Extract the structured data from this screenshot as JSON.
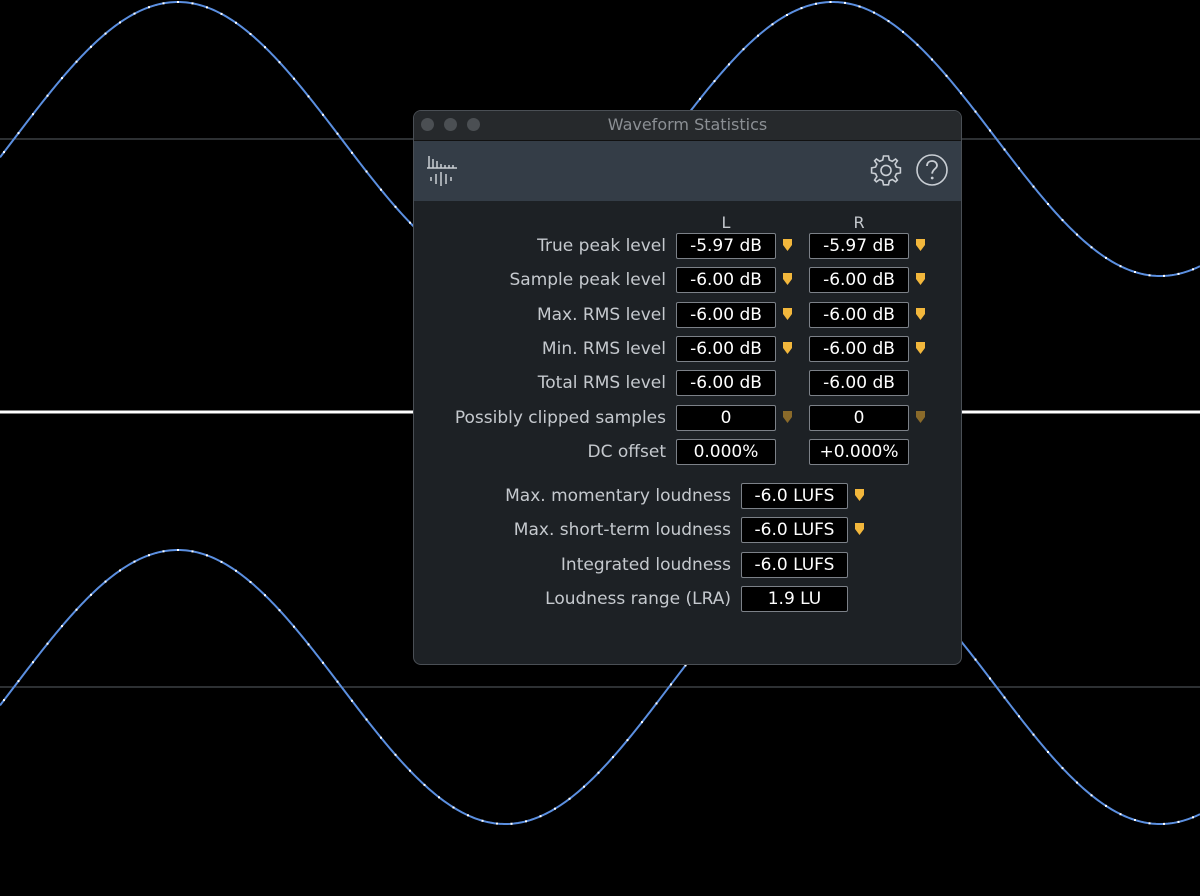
{
  "window": {
    "title": "Waveform Statistics"
  },
  "toolbar": {
    "icons": [
      "waveform-statistics-icon",
      "gear-icon",
      "help-icon"
    ]
  },
  "columns": {
    "left": "L",
    "right": "R"
  },
  "channel_stats": [
    {
      "label": "True peak level",
      "left": "-5.97 dB",
      "right": "-5.97 dB",
      "marker": "active"
    },
    {
      "label": "Sample peak level",
      "left": "-6.00 dB",
      "right": "-6.00 dB",
      "marker": "active"
    },
    {
      "label": "Max. RMS level",
      "left": "-6.00 dB",
      "right": "-6.00 dB",
      "marker": "active"
    },
    {
      "label": "Min. RMS level",
      "left": "-6.00 dB",
      "right": "-6.00 dB",
      "marker": "active"
    },
    {
      "label": "Total RMS level",
      "left": "-6.00 dB",
      "right": "-6.00 dB",
      "marker": "none"
    },
    {
      "label": "Possibly clipped samples",
      "left": "0",
      "right": "0",
      "marker": "dim"
    },
    {
      "label": "DC offset",
      "left": "0.000%",
      "right": "+0.000%",
      "marker": "none"
    }
  ],
  "loudness_stats": [
    {
      "label": "Max. momentary loudness",
      "value": "-6.0 LUFS",
      "marker": "active"
    },
    {
      "label": "Max. short-term loudness",
      "value": "-6.0 LUFS",
      "marker": "active"
    },
    {
      "label": "Integrated loudness",
      "value": "-6.0 LUFS",
      "marker": "none"
    },
    {
      "label": "Loudness range (LRA)",
      "value": "1.9 LU",
      "marker": "none"
    }
  ],
  "colors": {
    "waveform": "#5b8fe0",
    "waveform_sample": "#ffffff",
    "marker_active": "#f2b73c",
    "marker_dim": "#8a6a2a",
    "background": "#000000",
    "panel": "#1d2125",
    "toolbar": "#343d47"
  }
}
